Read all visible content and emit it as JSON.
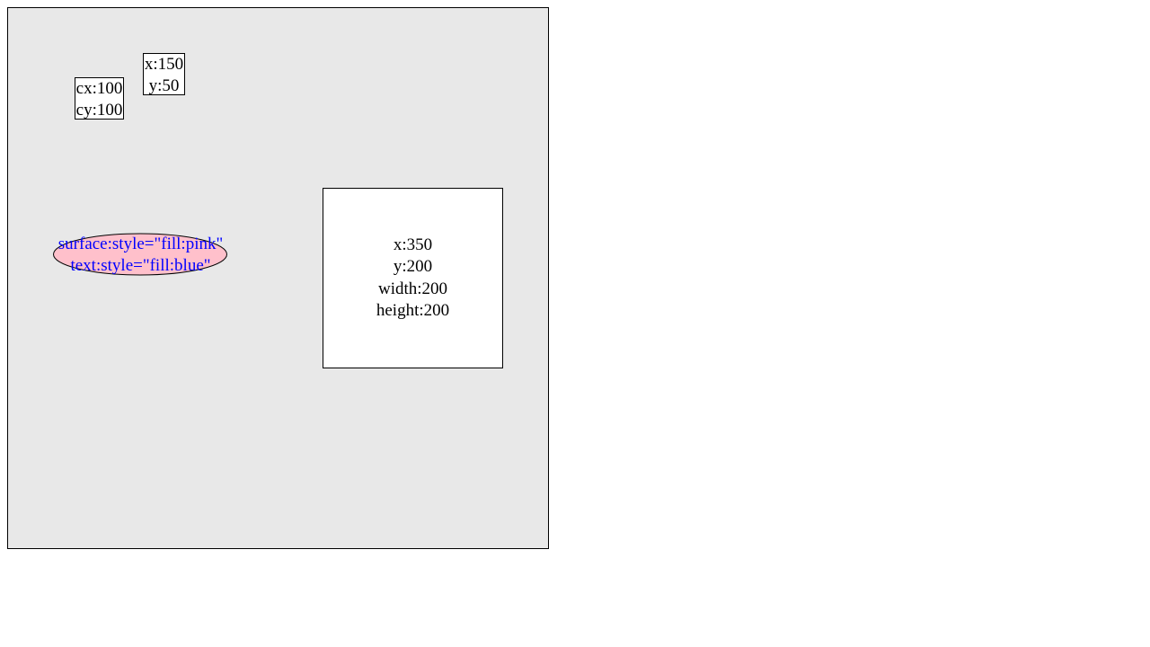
{
  "circle_label": {
    "line1": "cx:100",
    "line2": "cy:100"
  },
  "point_label": {
    "line1": "x:150",
    "line2": "y:50"
  },
  "ellipse": {
    "line1": "surface:style=\"fill:pink\"",
    "line2": "text:style=\"fill:blue\"",
    "fill": "#ffc0cb",
    "text_color": "#0000ff"
  },
  "rect_label": {
    "line1": "x:350",
    "line2": "y:200",
    "line3": "width:200",
    "line4": "height:200"
  },
  "colors": {
    "canvas_bg": "#e8e8e8",
    "box_fill": "#ffffff",
    "stroke": "#000000"
  }
}
